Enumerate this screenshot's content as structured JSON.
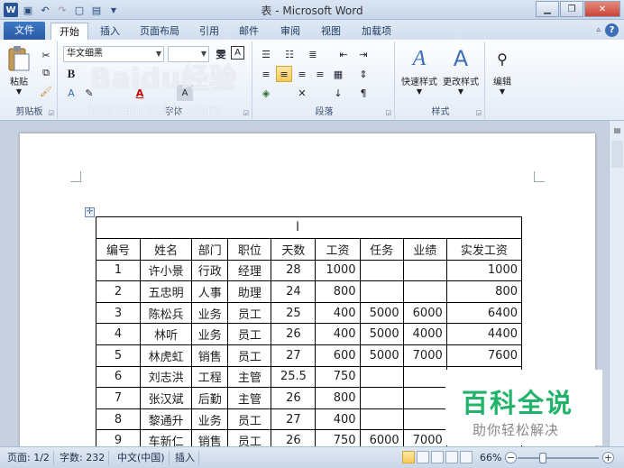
{
  "window": {
    "title": "表 - Microsoft Word",
    "logo": "W"
  },
  "qat": {
    "icons": [
      "save-icon",
      "undo-icon",
      "redo-icon",
      "new-doc-icon",
      "format-icon",
      "customize-icon"
    ]
  },
  "tabs": [
    {
      "id": "file",
      "label": "文件"
    },
    {
      "id": "home",
      "label": "开始"
    },
    {
      "id": "insert",
      "label": "插入"
    },
    {
      "id": "layout",
      "label": "页面布局"
    },
    {
      "id": "references",
      "label": "引用"
    },
    {
      "id": "mailings",
      "label": "邮件"
    },
    {
      "id": "review",
      "label": "审阅"
    },
    {
      "id": "view",
      "label": "视图"
    },
    {
      "id": "addins",
      "label": "加载项"
    }
  ],
  "ribbon": {
    "clipboard": {
      "label": "剪贴板",
      "paste": "粘贴"
    },
    "font": {
      "label": "字体",
      "font_name": "华文细黑",
      "wen": "雯",
      "a_box": "A",
      "bold": "B",
      "shading_a": "A",
      "highlight_a": "A"
    },
    "paragraph": {
      "label": "段落"
    },
    "styles": {
      "label": "样式",
      "quick": "快速样式",
      "change": "更改样式"
    },
    "editing": {
      "label": "编辑"
    }
  },
  "watermark": {
    "main": "Baidu经验",
    "url": "jingyan.baidu.com"
  },
  "table": {
    "headers": [
      "编号",
      "姓名",
      "部门",
      "职位",
      "天数",
      "工资",
      "任务",
      "业绩",
      "实发工资"
    ],
    "rows": [
      [
        "1",
        "许小景",
        "行政",
        "经理",
        "28",
        "1000",
        "",
        "",
        "1000"
      ],
      [
        "2",
        "五忠明",
        "人事",
        "助理",
        "24",
        "800",
        "",
        "",
        "800"
      ],
      [
        "3",
        "陈松兵",
        "业务",
        "员工",
        "25",
        "400",
        "5000",
        "6000",
        "6400"
      ],
      [
        "4",
        "林听",
        "业务",
        "员工",
        "26",
        "400",
        "5000",
        "4000",
        "4400"
      ],
      [
        "5",
        "林虎虹",
        "销售",
        "员工",
        "27",
        "600",
        "5000",
        "7000",
        "7600"
      ],
      [
        "6",
        "刘志洪",
        "工程",
        "主管",
        "25.5",
        "750",
        "",
        "",
        "750"
      ],
      [
        "7",
        "张汉斌",
        "后勤",
        "主管",
        "26",
        "800",
        "",
        "",
        ""
      ],
      [
        "8",
        "黎通升",
        "业务",
        "员工",
        "27",
        "400",
        "",
        "",
        ""
      ],
      [
        "9",
        "车新仁",
        "销售",
        "员工",
        "26",
        "750",
        "6000",
        "7000",
        ""
      ]
    ]
  },
  "status": {
    "page": "页面: 1/2",
    "words": "字数: 232",
    "lang": "中文(中国)",
    "mode": "插入",
    "zoom": "66%"
  },
  "brand": {
    "line1": "百科全说",
    "line2": "助你轻松解决"
  }
}
